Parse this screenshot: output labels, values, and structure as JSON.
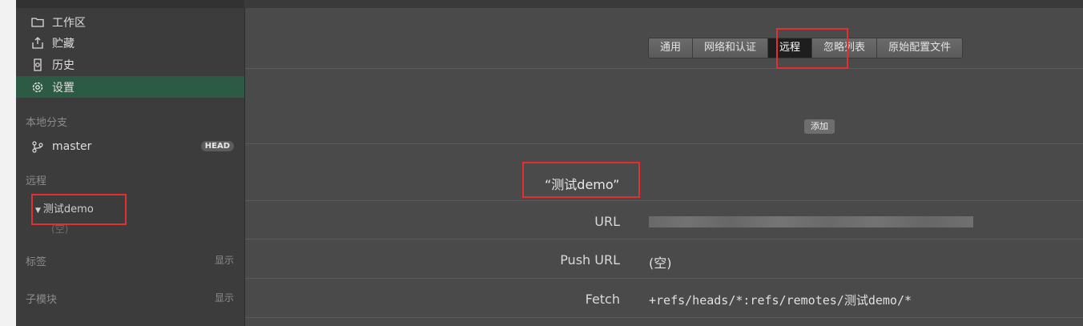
{
  "sidebar": {
    "nav": [
      {
        "label": "工作区",
        "icon": "folder-icon"
      },
      {
        "label": "贮藏",
        "icon": "stash-icon"
      },
      {
        "label": "历史",
        "icon": "history-icon"
      },
      {
        "label": "设置",
        "icon": "gear-icon"
      }
    ],
    "local_branches_title": "本地分支",
    "branch": {
      "name": "master",
      "badge": "HEAD"
    },
    "remotes_title": "远程",
    "remote": {
      "name": "测试demo",
      "empty": "(空)"
    },
    "tags_title": "标签",
    "tags_show": "显示",
    "submodules_title": "子模块",
    "submodules_show": "显示"
  },
  "tabs": [
    "通用",
    "网络和认证",
    "远程",
    "忽略列表",
    "原始配置文件"
  ],
  "active_tab": "远程",
  "add_button": "添加",
  "remote_detail": {
    "title": "“测试demo”",
    "url_label": "URL",
    "push_url_label": "Push URL",
    "push_url_value": "(空)",
    "fetch_label": "Fetch",
    "fetch_value": "+refs/heads/*:refs/remotes/测试demo/*"
  },
  "colors": {
    "active_nav": "#2d5a44",
    "highlight": "#e03030",
    "panel": "#4a4a4a",
    "sidebar": "#3c3c3c"
  }
}
